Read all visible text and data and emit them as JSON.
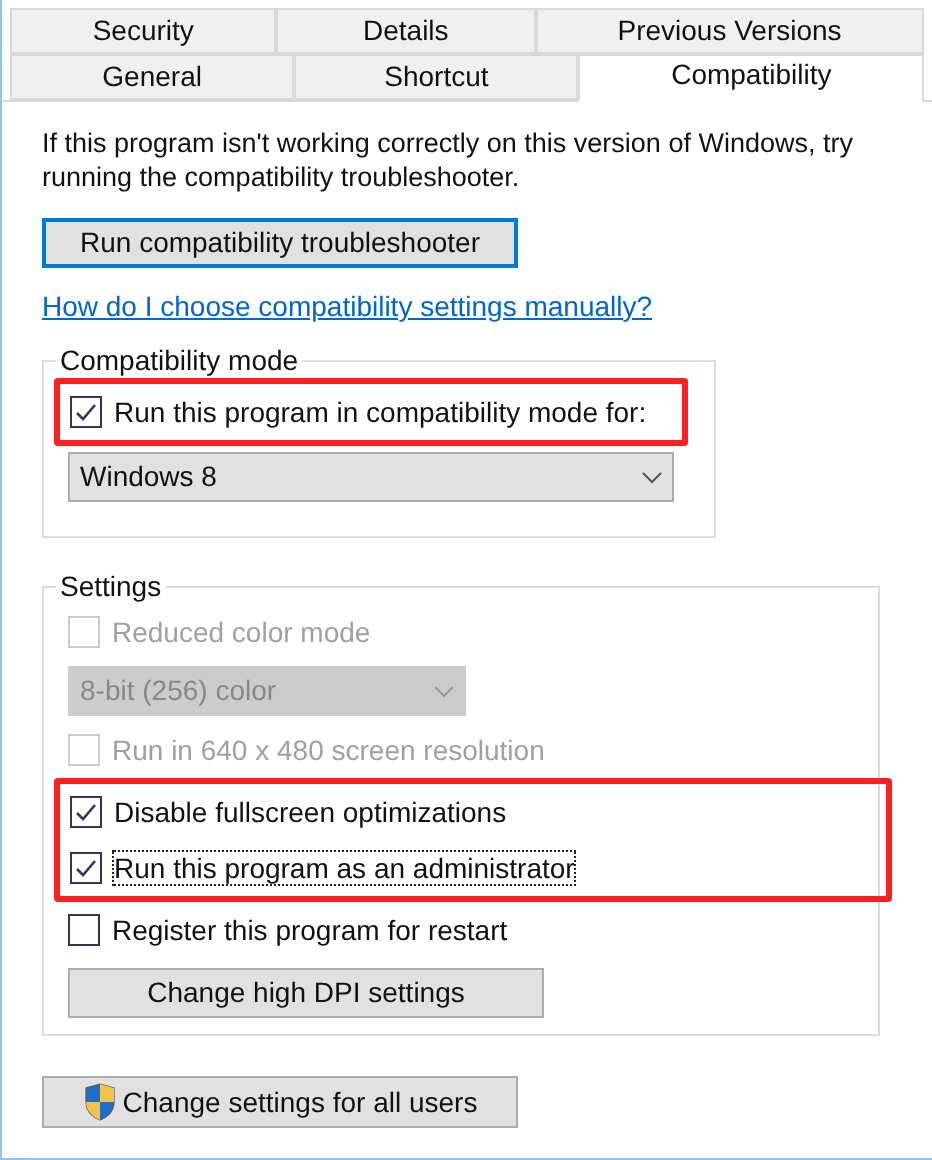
{
  "tabs": [
    [
      {
        "label": "Security",
        "selected": false
      },
      {
        "label": "Details",
        "selected": false
      },
      {
        "label": "Previous Versions",
        "selected": false
      }
    ],
    [
      {
        "label": "General",
        "selected": false
      },
      {
        "label": "Shortcut",
        "selected": false
      },
      {
        "label": "Compatibility",
        "selected": true
      }
    ]
  ],
  "intro": "If this program isn't working correctly on this version of Windows, try running the compatibility troubleshooter.",
  "troubleshooter_button": "Run compatibility troubleshooter",
  "help_link": "How do I choose compatibility settings manually?",
  "compatibility_mode": {
    "title": "Compatibility mode",
    "items": [
      {
        "kind": "checkbox",
        "label": "Run this program in compatibility mode for:",
        "checked": true,
        "disabled": false,
        "highlighted": true,
        "focused": false
      },
      {
        "kind": "select",
        "value": "Windows 8",
        "disabled": false,
        "highlighted": false
      }
    ]
  },
  "settings": {
    "title": "Settings",
    "items": [
      {
        "kind": "checkbox",
        "label": "Reduced color mode",
        "checked": false,
        "disabled": true,
        "highlighted": false,
        "focused": false
      },
      {
        "kind": "select",
        "value": "8-bit (256) color",
        "disabled": true,
        "highlighted": false
      },
      {
        "kind": "checkbox",
        "label": "Run in 640 x 480 screen resolution",
        "checked": false,
        "disabled": true,
        "highlighted": false,
        "focused": false
      },
      {
        "kind": "checkbox",
        "label": "Disable fullscreen optimizations",
        "checked": true,
        "disabled": false,
        "highlighted": true,
        "focused": false
      },
      {
        "kind": "checkbox",
        "label": "Run this program as an administrator",
        "checked": true,
        "disabled": false,
        "highlighted": true,
        "focused": true
      },
      {
        "kind": "checkbox",
        "label": "Register this program for restart",
        "checked": false,
        "disabled": false,
        "highlighted": false,
        "focused": false
      },
      {
        "kind": "button",
        "label": "Change high DPI settings"
      }
    ]
  },
  "all_users_button": "Change settings for all users"
}
